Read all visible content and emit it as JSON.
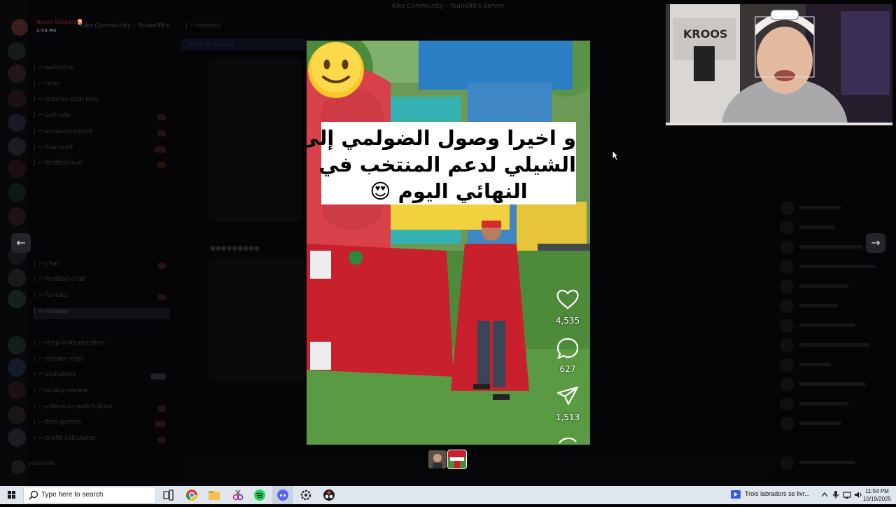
{
  "window": {
    "title": "Kiks Community - Youne99's Server"
  },
  "user": {
    "name": "Nanni Stickers🍿",
    "time": "4:59 PM",
    "server_title": "Kiks Community - Youne99's"
  },
  "channels": [
    {
      "label": "| ⌐-welcome"
    },
    {
      "label": "| ⌐-roles"
    },
    {
      "label": "| ⌐-movies-dyal-kiks"
    },
    {
      "label": "| ⌐-self-role"
    },
    {
      "label": "| ⌐-announcement"
    },
    {
      "label": "| ⌐-live-notif"
    },
    {
      "label": "| ⌐-football-live"
    },
    {
      "label": "| ⌐-chat"
    },
    {
      "label": "| ⌐-football-chat"
    },
    {
      "label": "| ⌐-funtass"
    },
    {
      "label": "| ⌐-memes"
    },
    {
      "label": "| ⌐-drop-links-reaction"
    },
    {
      "label": "| ⌐-stream-clips"
    },
    {
      "label": "| ⌐-alphabets"
    },
    {
      "label": "| ⌐-piracy-review"
    },
    {
      "label": "| ⌐-videos-to-watch-links"
    },
    {
      "label": "| ⌐-free-games"
    },
    {
      "label": "| ⌐-profit-calculator"
    }
  ],
  "channel_header": "| ⌐-memes",
  "banner": "Jump to present",
  "bottom_user": "youne99s",
  "viewer": {
    "prev_label": "←",
    "next_label": "→",
    "caption_lines": [
      "و اخيرا وصول الضولمي إلى",
      "الشيلي لدعم المنتخب في",
      "النهائي اليوم 😍"
    ],
    "likes": "4,535",
    "comments": "627",
    "shares": "1,513",
    "emoji_icon": "slightly-smiling-face-icon"
  },
  "taskbar": {
    "search_placeholder": "Type here to search",
    "media_title": "Trois labradors se livr...",
    "time": "11:54 PM",
    "date": "10/19/2025"
  },
  "colors": {
    "caption_bg": "#ffffff",
    "cape_red": "#c8202c",
    "taskbar_bg": "#dfe6ee"
  }
}
